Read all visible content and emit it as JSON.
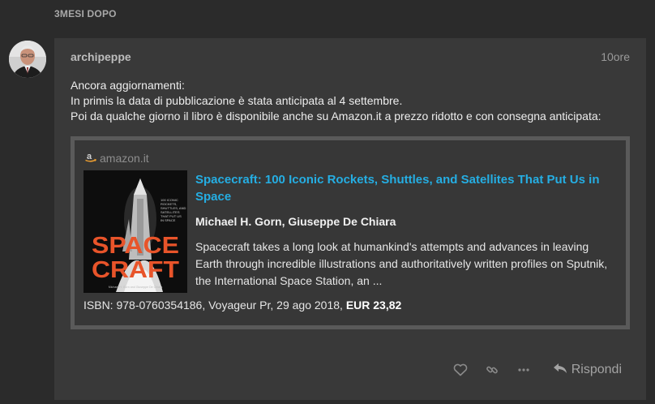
{
  "time_gap": "3MESI DOPO",
  "post": {
    "username": "archipeppe",
    "time": "10ore",
    "lines": [
      "Ancora aggiornamenti:",
      "In primis la data di pubblicazione è stata anticipata al 4 settembre.",
      "Poi da qualche giorno il libro è disponibile anche su Amazon.it a prezzo ridotto e con consegna anticipata:"
    ]
  },
  "onebox": {
    "source": "amazon.it",
    "title": "Spacecraft: 100 Iconic Rockets, Shuttles, and Satellites That Put Us in Space",
    "authors": "Michael H. Gorn, Giuseppe De Chiara",
    "description": "Spacecraft takes a long look at humankind's attempts and advances in leaving Earth through incredible illustrations and authoritatively written profiles on Sputnik, the International Space Station, an ...",
    "footer_text": "ISBN: 978-0760354186, Voyageur Pr, 29 ago 2018, ",
    "price": "EUR 23,82",
    "cover": {
      "word1": "SPACE",
      "word2": "CRAFT",
      "subtitle": [
        "100 ICONIC",
        "ROCKETS,",
        "SHUTTLES, AND",
        "SATELLITES",
        "THAT PUT US",
        "IN SPACE"
      ],
      "authors": "Michael H. Gorn and Giuseppe De Chiara"
    }
  },
  "actions": {
    "reply_label": "Rispondi",
    "icons": [
      "heart-icon",
      "link-icon",
      "more-icon",
      "reply-icon"
    ]
  },
  "colors": {
    "link": "#25aee3",
    "cover_orange": "#e8542a",
    "amazon_orange": "#f0a030"
  }
}
